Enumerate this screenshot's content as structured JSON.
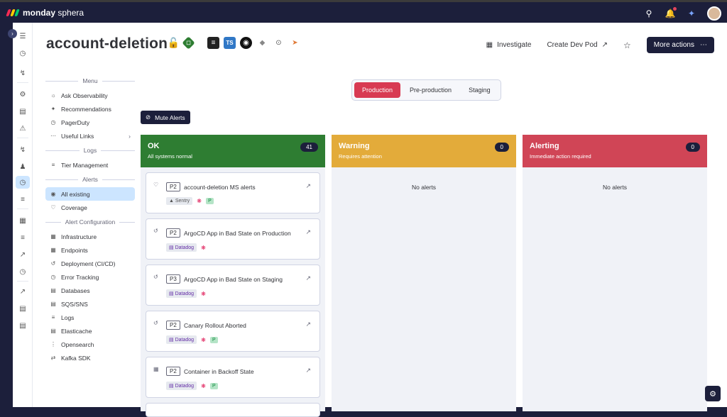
{
  "app": {
    "brand_bold": "monday",
    "brand_light": "sphera"
  },
  "header": {
    "title": "account-deletion",
    "investigate": "Investigate",
    "create_dev_pod": "Create Dev Pod",
    "more_actions": "More actions"
  },
  "sidebar": {
    "menu_label": "Menu",
    "menu_items": [
      "Ask Observability",
      "Recommendations",
      "PagerDuty",
      "Useful Links"
    ],
    "logs_label": "Logs",
    "logs_items": [
      "Tier Management"
    ],
    "alerts_label": "Alerts",
    "alerts_items": [
      "All existing",
      "Coverage"
    ],
    "alertcfg_label": "Alert Configuration",
    "alertcfg_items": [
      "Infrastructure",
      "Endpoints",
      "Deployment (CI/CD)",
      "Error Tracking",
      "Databases",
      "SQS/SNS",
      "Logs",
      "Elasticache",
      "Opensearch",
      "Kafka SDK"
    ]
  },
  "env_tabs": [
    "Production",
    "Pre-production",
    "Staging"
  ],
  "mute_alerts": "Mute Alerts",
  "columns": {
    "ok": {
      "title": "OK",
      "subtitle": "All systems normal",
      "count": "41",
      "color": "#2e7d32"
    },
    "warning": {
      "title": "Warning",
      "subtitle": "Requires attention",
      "count": "0",
      "color": "#e3ab3a",
      "empty": "No alerts"
    },
    "alerting": {
      "title": "Alerting",
      "subtitle": "Immediate action required",
      "count": "0",
      "color": "#d04556",
      "empty": "No alerts"
    }
  },
  "cards": [
    {
      "priority": "P2",
      "name": "account-deletion MS alerts",
      "tag": "Sentry",
      "pagerduty": "P"
    },
    {
      "priority": "P2",
      "name": "ArgoCD App in Bad State on Production",
      "tag": "Datadog"
    },
    {
      "priority": "P3",
      "name": "ArgoCD App in Bad State on Staging",
      "tag": "Datadog"
    },
    {
      "priority": "P2",
      "name": "Canary Rollout Aborted",
      "tag": "Datadog",
      "pagerduty": "P"
    },
    {
      "priority": "P2",
      "name": "Container in Backoff State",
      "tag": "Datadog",
      "pagerduty": "P"
    }
  ]
}
